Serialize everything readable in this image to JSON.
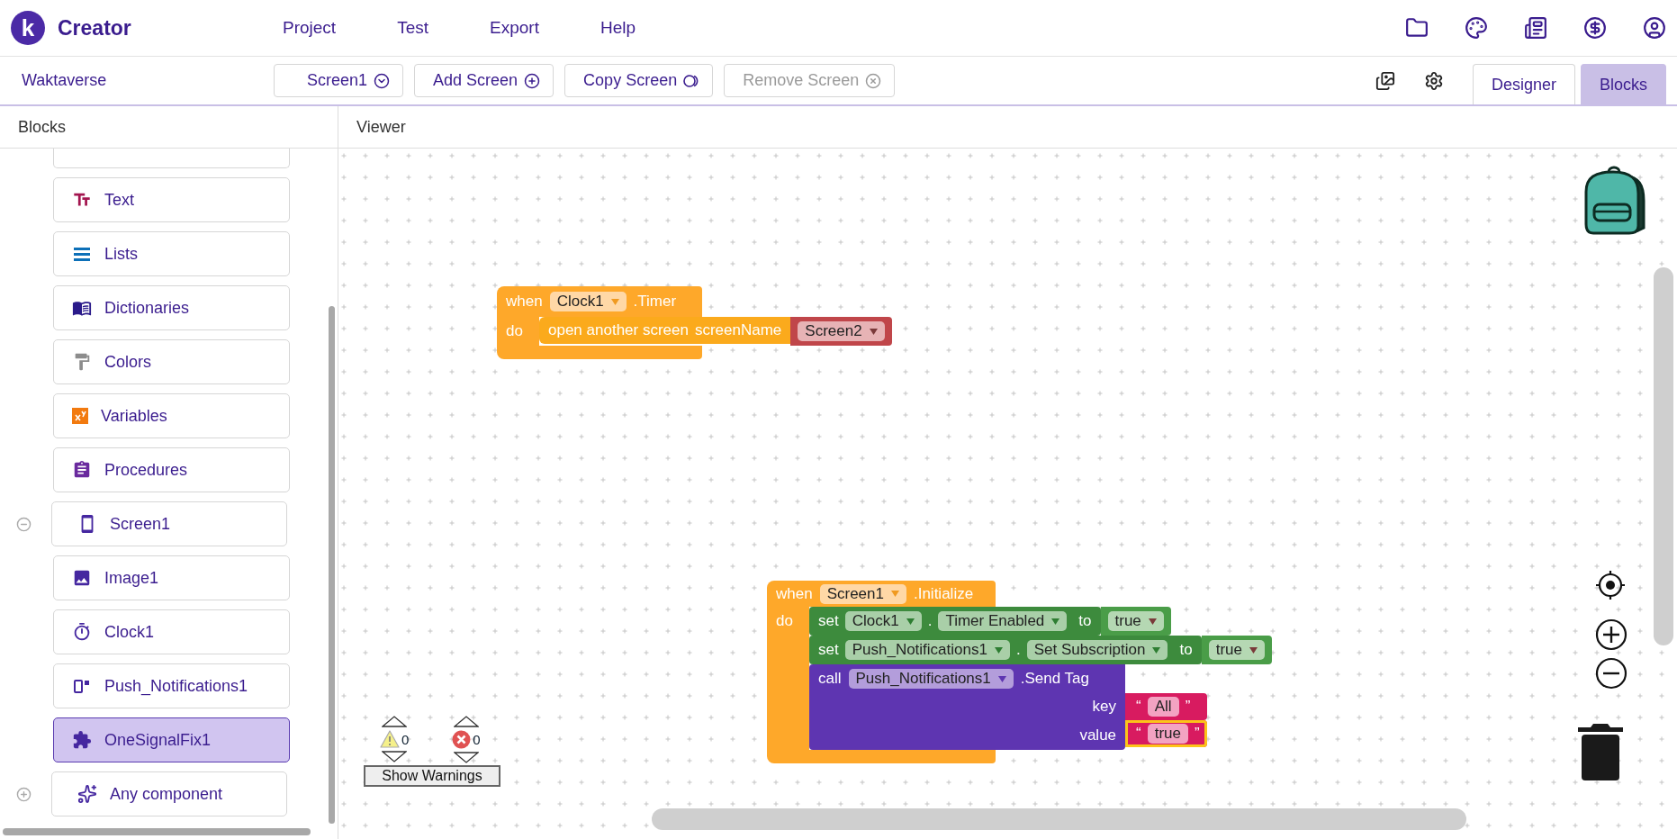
{
  "header": {
    "logo": "k",
    "app_name": "Creator",
    "menu": [
      {
        "label": "Project"
      },
      {
        "label": "Test"
      },
      {
        "label": "Export"
      },
      {
        "label": "Help"
      }
    ]
  },
  "toolbar": {
    "project": "Waktaverse",
    "screen_buttons": [
      {
        "kind": "screen_select",
        "label": "Screen1",
        "disabled": false
      },
      {
        "kind": "add",
        "label": "Add Screen",
        "disabled": false
      },
      {
        "kind": "copy",
        "label": "Copy Screen",
        "disabled": false
      },
      {
        "kind": "remove",
        "label": "Remove Screen",
        "disabled": true
      }
    ],
    "view_tabs": [
      {
        "label": "Designer",
        "selected": false
      },
      {
        "label": "Blocks",
        "selected": true
      }
    ]
  },
  "sidebar": {
    "title": "Blocks",
    "items": [
      {
        "label": "Text",
        "kind": "text",
        "selected": false
      },
      {
        "label": "Lists",
        "kind": "lists",
        "selected": false
      },
      {
        "label": "Dictionaries",
        "kind": "dictionaries",
        "selected": false
      },
      {
        "label": "Colors",
        "kind": "colors",
        "selected": false
      },
      {
        "label": "Variables",
        "kind": "variables",
        "selected": false
      },
      {
        "label": "Procedures",
        "kind": "procedures",
        "selected": false
      }
    ],
    "components": [
      {
        "label": "Screen1",
        "kind": "screen",
        "expanded": true,
        "selected": false,
        "children": [
          {
            "label": "Image1",
            "kind": "image",
            "selected": false
          },
          {
            "label": "Clock1",
            "kind": "clock",
            "selected": false
          },
          {
            "label": "Push_Notifications1",
            "kind": "notifications",
            "selected": false
          },
          {
            "label": "OneSignalFix1",
            "kind": "extension",
            "selected": true
          }
        ]
      },
      {
        "label": "Any component",
        "kind": "any",
        "expanded": false,
        "selected": false
      }
    ]
  },
  "viewer": {
    "title": "Viewer",
    "blocks": [
      {
        "kind": "event",
        "word": "when",
        "component": "Clock1",
        "event": ".Timer",
        "do_label": "do",
        "body": [
          {
            "kind": "control",
            "label": "open another screen",
            "socket": "screenName",
            "value": {
              "kind": "screen_name",
              "text": "Screen2"
            }
          }
        ]
      },
      {
        "kind": "event",
        "word": "when",
        "component": "Screen1",
        "event": ".Initialize",
        "do_label": "do",
        "body": [
          {
            "kind": "setter",
            "word": "set",
            "component": "Clock1",
            "dot": ".",
            "property": "Timer Enabled",
            "to": "to",
            "value": {
              "kind": "logic",
              "text": "true"
            }
          },
          {
            "kind": "setter",
            "word": "set",
            "component": "Push_Notifications1",
            "dot": ".",
            "property": "Set Subscription",
            "to": "to",
            "value": {
              "kind": "logic",
              "text": "true"
            }
          },
          {
            "kind": "method",
            "word": "call",
            "component": "Push_Notifications1",
            "method": ".Send Tag",
            "args": [
              {
                "name": "key",
                "value": {
                  "kind": "text",
                  "open_quote": "“",
                  "text": "All",
                  "close_quote": "”",
                  "selected": false
                }
              },
              {
                "name": "value",
                "value": {
                  "kind": "text",
                  "open_quote": "“",
                  "text": "true",
                  "close_quote": "”",
                  "selected": true
                }
              }
            ]
          }
        ]
      }
    ],
    "warnings": {
      "warning_count": "0",
      "error_count": "0",
      "button": "Show Warnings"
    }
  }
}
